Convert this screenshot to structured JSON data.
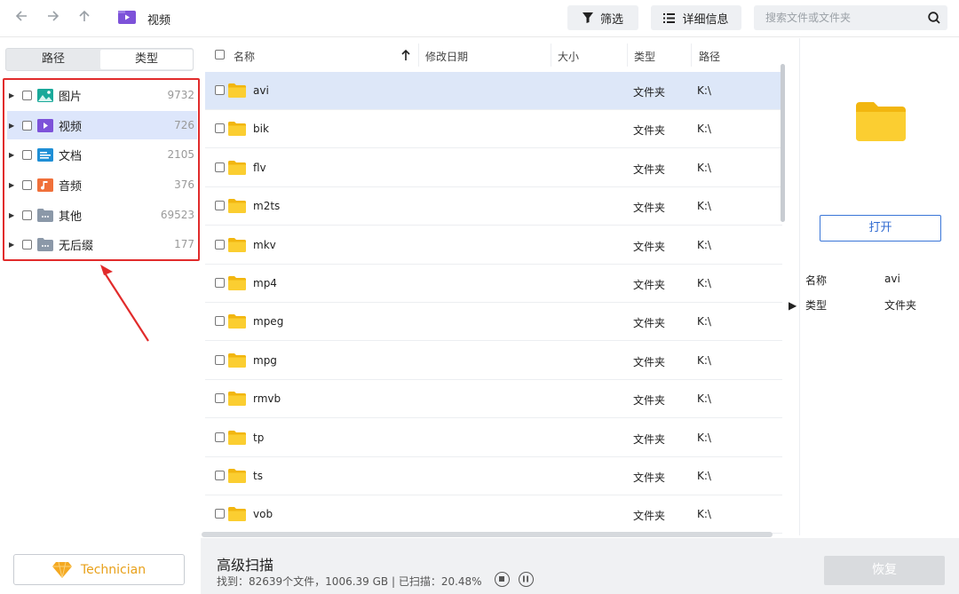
{
  "window": {
    "title": "视频"
  },
  "toolbar": {
    "back_icon": "back-arrow-icon",
    "forward_icon": "forward-arrow-icon",
    "up_icon": "up-arrow-icon",
    "filter_label": "筛选",
    "details_label": "详细信息",
    "search_placeholder": "搜索文件或文件夹"
  },
  "sidebar": {
    "tabs": [
      {
        "label": "路径",
        "active": false
      },
      {
        "label": "类型",
        "active": true
      }
    ],
    "categories": [
      {
        "label": "图片",
        "count": "9732",
        "icon": "image-icon",
        "selected": false
      },
      {
        "label": "视频",
        "count": "726",
        "icon": "video-icon",
        "selected": true
      },
      {
        "label": "文档",
        "count": "2105",
        "icon": "document-icon",
        "selected": false
      },
      {
        "label": "音频",
        "count": "376",
        "icon": "audio-icon",
        "selected": false
      },
      {
        "label": "其他",
        "count": "69523",
        "icon": "other-folder-icon",
        "selected": false
      },
      {
        "label": "无后缀",
        "count": "177",
        "icon": "no-extension-folder-icon",
        "selected": false
      }
    ],
    "technician_label": "Technician"
  },
  "table": {
    "columns": {
      "name": "名称",
      "modified": "修改日期",
      "size": "大小",
      "type": "类型",
      "path": "路径"
    },
    "rows": [
      {
        "name": "avi",
        "type": "文件夹",
        "path": "K:\\",
        "selected": true
      },
      {
        "name": "bik",
        "type": "文件夹",
        "path": "K:\\"
      },
      {
        "name": "flv",
        "type": "文件夹",
        "path": "K:\\"
      },
      {
        "name": "m2ts",
        "type": "文件夹",
        "path": "K:\\"
      },
      {
        "name": "mkv",
        "type": "文件夹",
        "path": "K:\\"
      },
      {
        "name": "mp4",
        "type": "文件夹",
        "path": "K:\\"
      },
      {
        "name": "mpeg",
        "type": "文件夹",
        "path": "K:\\"
      },
      {
        "name": "mpg",
        "type": "文件夹",
        "path": "K:\\"
      },
      {
        "name": "rmvb",
        "type": "文件夹",
        "path": "K:\\"
      },
      {
        "name": "tp",
        "type": "文件夹",
        "path": "K:\\"
      },
      {
        "name": "ts",
        "type": "文件夹",
        "path": "K:\\"
      },
      {
        "name": "vob",
        "type": "文件夹",
        "path": "K:\\"
      }
    ]
  },
  "preview": {
    "open_label": "打开",
    "props": [
      {
        "label": "名称",
        "value": "avi"
      },
      {
        "label": "类型",
        "value": "文件夹"
      }
    ]
  },
  "status": {
    "title": "高级扫描",
    "summary": "找到：82639个文件，1006.39 GB | 已扫描：20.48%",
    "recover_label": "恢复"
  },
  "colors": {
    "accent": "#2f6ad1",
    "highlight_border": "#e12b2b",
    "selected_row": "#dde7f8",
    "folder": "#f7c31c"
  }
}
